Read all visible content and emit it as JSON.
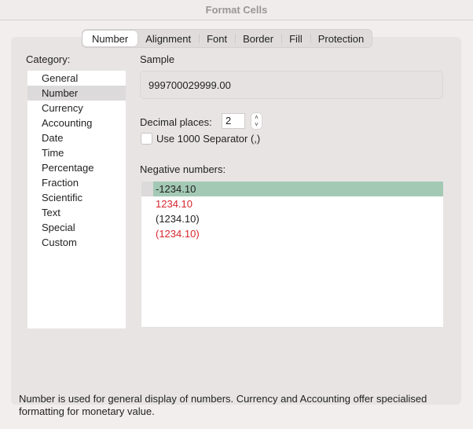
{
  "window": {
    "title": "Format Cells"
  },
  "tabs": [
    {
      "label": "Number",
      "active": true
    },
    {
      "label": "Alignment",
      "active": false
    },
    {
      "label": "Font",
      "active": false
    },
    {
      "label": "Border",
      "active": false
    },
    {
      "label": "Fill",
      "active": false
    },
    {
      "label": "Protection",
      "active": false
    }
  ],
  "category": {
    "label": "Category:",
    "selected": "Number",
    "items": [
      "General",
      "Number",
      "Currency",
      "Accounting",
      "Date",
      "Time",
      "Percentage",
      "Fraction",
      "Scientific",
      "Text",
      "Special",
      "Custom"
    ]
  },
  "sample": {
    "label": "Sample",
    "value": "999700029999.00"
  },
  "decimal_places": {
    "label": "Decimal places:",
    "value": "2",
    "up_icon": "chevron-up",
    "down_icon": "chevron-down"
  },
  "thousand_separator": {
    "label": "Use 1000 Separator (,)",
    "checked": false
  },
  "negative_numbers": {
    "label": "Negative numbers:",
    "selected_index": 0,
    "items": [
      {
        "text": "-1234.10",
        "color": "#111111"
      },
      {
        "text": "1234.10",
        "color": "#d6262d"
      },
      {
        "text": "(1234.10)",
        "color": "#111111"
      },
      {
        "text": "(1234.10)",
        "color": "#d6262d"
      }
    ]
  },
  "description": "Number is used for general display of numbers.  Currency and Accounting offer specialised formatting for monetary value."
}
